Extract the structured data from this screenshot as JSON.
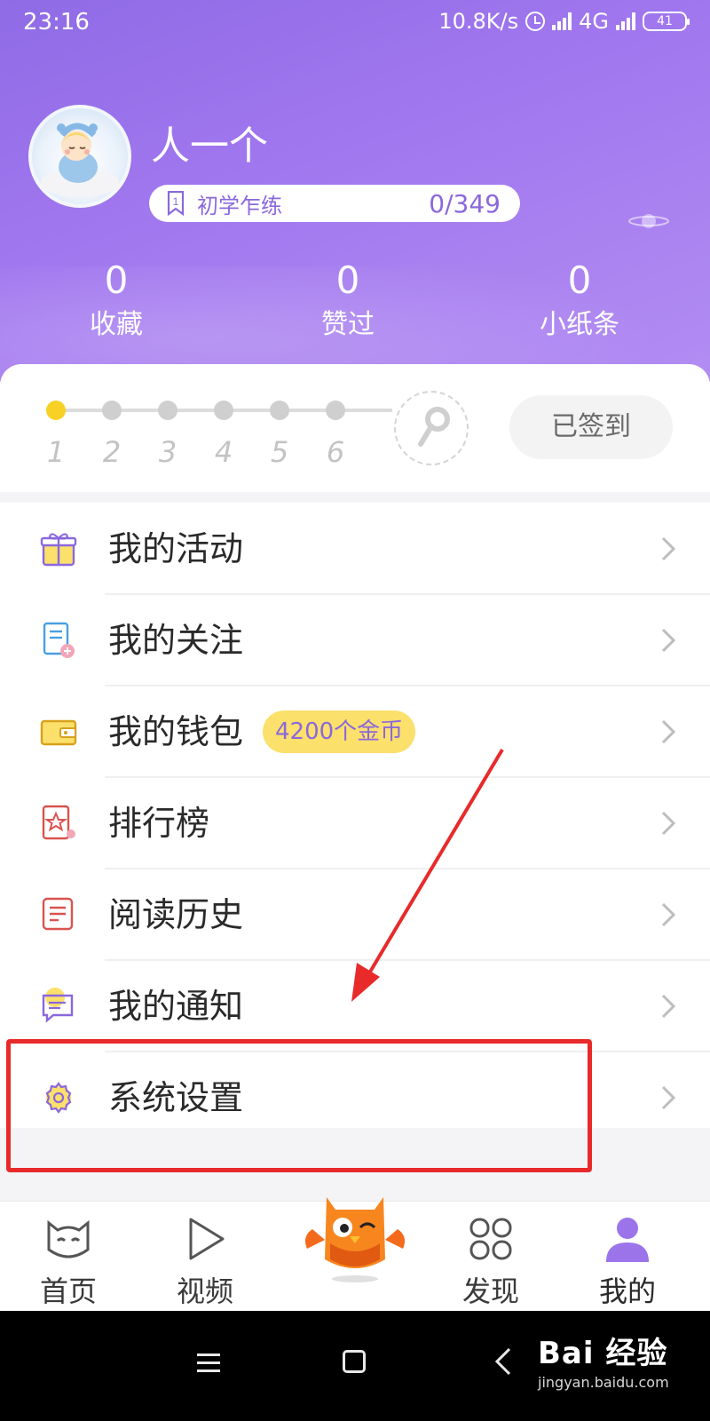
{
  "status_bar": {
    "time": "23:16",
    "net_speed": "10.8K/s",
    "network": "4G",
    "battery": "41"
  },
  "profile": {
    "username": "人一个",
    "level_label": "初学乍练",
    "level_progress": "0/349"
  },
  "stats": [
    {
      "value": "0",
      "label": "收藏"
    },
    {
      "value": "0",
      "label": "赞过"
    },
    {
      "value": "0",
      "label": "小纸条"
    }
  ],
  "checkin": {
    "days": [
      "1",
      "2",
      "3",
      "4",
      "5",
      "6"
    ],
    "active_day": 1,
    "button_label": "已签到"
  },
  "menu": [
    {
      "label": "我的活动",
      "icon": "gift-icon"
    },
    {
      "label": "我的关注",
      "icon": "follow-list-icon"
    },
    {
      "label": "我的钱包",
      "icon": "wallet-icon",
      "badge": "4200个金币"
    },
    {
      "label": "排行榜",
      "icon": "ranking-icon"
    },
    {
      "label": "阅读历史",
      "icon": "history-icon"
    },
    {
      "label": "我的通知",
      "icon": "notification-icon"
    },
    {
      "label": "系统设置",
      "icon": "settings-gear-icon"
    }
  ],
  "tabs": [
    {
      "label": "首页",
      "icon": "cat-home-icon"
    },
    {
      "label": "视频",
      "icon": "play-video-icon"
    },
    {
      "label": "",
      "icon": "owl-mascot-icon"
    },
    {
      "label": "发现",
      "icon": "discover-clover-icon"
    },
    {
      "label": "我的",
      "icon": "user-profile-icon",
      "active": true
    }
  ],
  "watermark": {
    "logo": "Bai 经验",
    "url": "jingyan.baidu.com"
  },
  "colors": {
    "header_purple": "#9b74ea",
    "accent_purple": "#8a68dd",
    "coin_yellow": "#fbe06b",
    "checkin_dot": "#f7d126",
    "highlight_red": "#e82a2a"
  }
}
